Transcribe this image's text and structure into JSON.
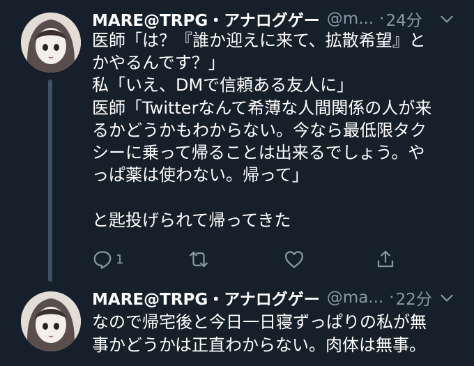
{
  "tweets": [
    {
      "display_name": "MARE@TRPG・アナログゲー",
      "handle": "@m...",
      "dot": "·",
      "time": "24分",
      "text": "医師「は？『誰か迎えに来て、拡散希望』と\nかやるんです？」\n私「いえ、DMで信頼ある友人に」\n医師「Twitterなんて希薄な人間関係の人が来\nるかどうかもわからない。今なら最低限タク\nシーに乗って帰ることは出来るでしょう。や\nっぱ薬は使わない。帰って」\n\nと匙投げられて帰ってきた",
      "reply_count": "1",
      "icons": {
        "reply": "reply-icon",
        "retweet": "retweet-icon",
        "like": "heart-icon",
        "share": "share-icon",
        "menu": "chevron-down-icon"
      }
    },
    {
      "display_name": "MARE@TRPG・アナログゲー",
      "handle": "@ma...",
      "dot": "·",
      "time": "22分",
      "text": "なので帰宅後と今日一日寝ずっぱりの私が無\n事かどうかは正直わからない。肉体は無事。",
      "icons": {
        "menu": "chevron-down-icon"
      }
    }
  ],
  "colors": {
    "background": "#15202b",
    "secondary_text": "#8899a6",
    "thread_line": "#3d5466"
  }
}
